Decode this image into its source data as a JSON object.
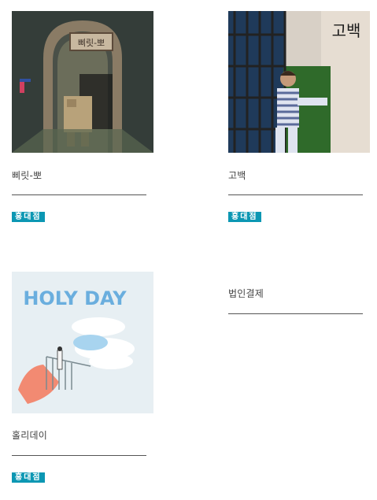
{
  "products": [
    {
      "title": "삐릿-뽀",
      "badge": "홍대점",
      "cover_text": "삐릿-뽀"
    },
    {
      "title": "고백",
      "badge": "홍대점",
      "cover_text": "고백"
    },
    {
      "title": "홀리데이",
      "badge": "홍대점",
      "cover_text": "HOLY DAY"
    },
    {
      "title": "법인결제"
    }
  ],
  "colors": {
    "badge": "#0c97b3",
    "rule": "#555555"
  }
}
